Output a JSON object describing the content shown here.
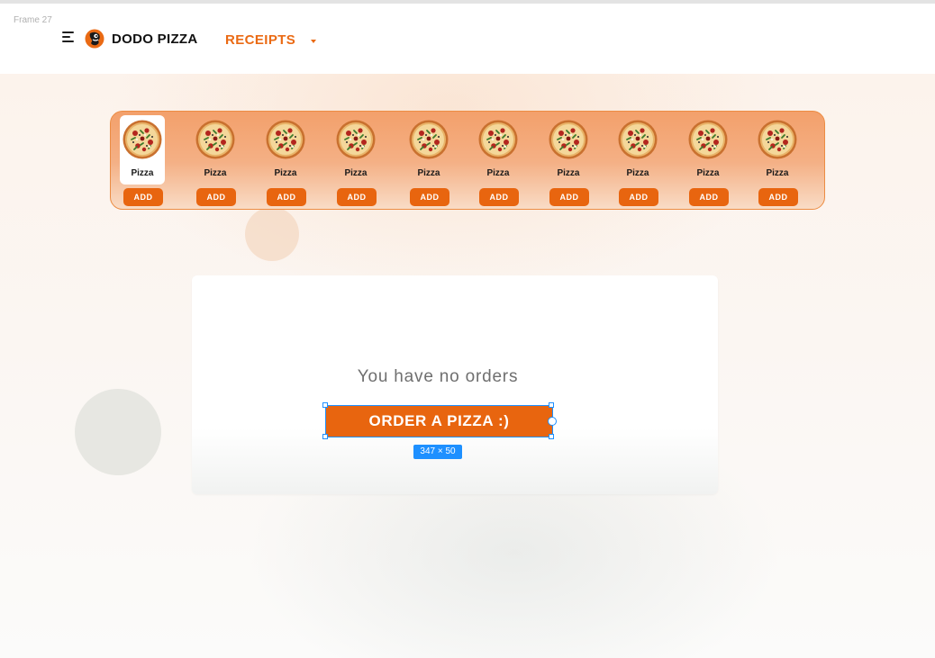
{
  "editor": {
    "frame_label": "Frame 27",
    "selection_size": "347 × 50"
  },
  "header": {
    "brand": "DODO PIZZA",
    "nav_label": "RECEIPTS"
  },
  "carousel": {
    "items": [
      {
        "name": "Pizza",
        "button": "ADD",
        "active": true
      },
      {
        "name": "Pizza",
        "button": "ADD"
      },
      {
        "name": "Pizza",
        "button": "ADD"
      },
      {
        "name": "Pizza",
        "button": "ADD"
      },
      {
        "name": "Pizza",
        "button": "ADD"
      },
      {
        "name": "Pizza",
        "button": "ADD"
      },
      {
        "name": "Pizza",
        "button": "ADD"
      },
      {
        "name": "Pizza",
        "button": "ADD"
      },
      {
        "name": "Pizza",
        "button": "ADD"
      },
      {
        "name": "Pizza",
        "button": "ADD"
      }
    ]
  },
  "orders": {
    "empty_message": "You have no orders",
    "cta_label": "ORDER A PIZZA :)"
  },
  "colors": {
    "accent": "#e8650f",
    "selection": "#1e90ff"
  }
}
